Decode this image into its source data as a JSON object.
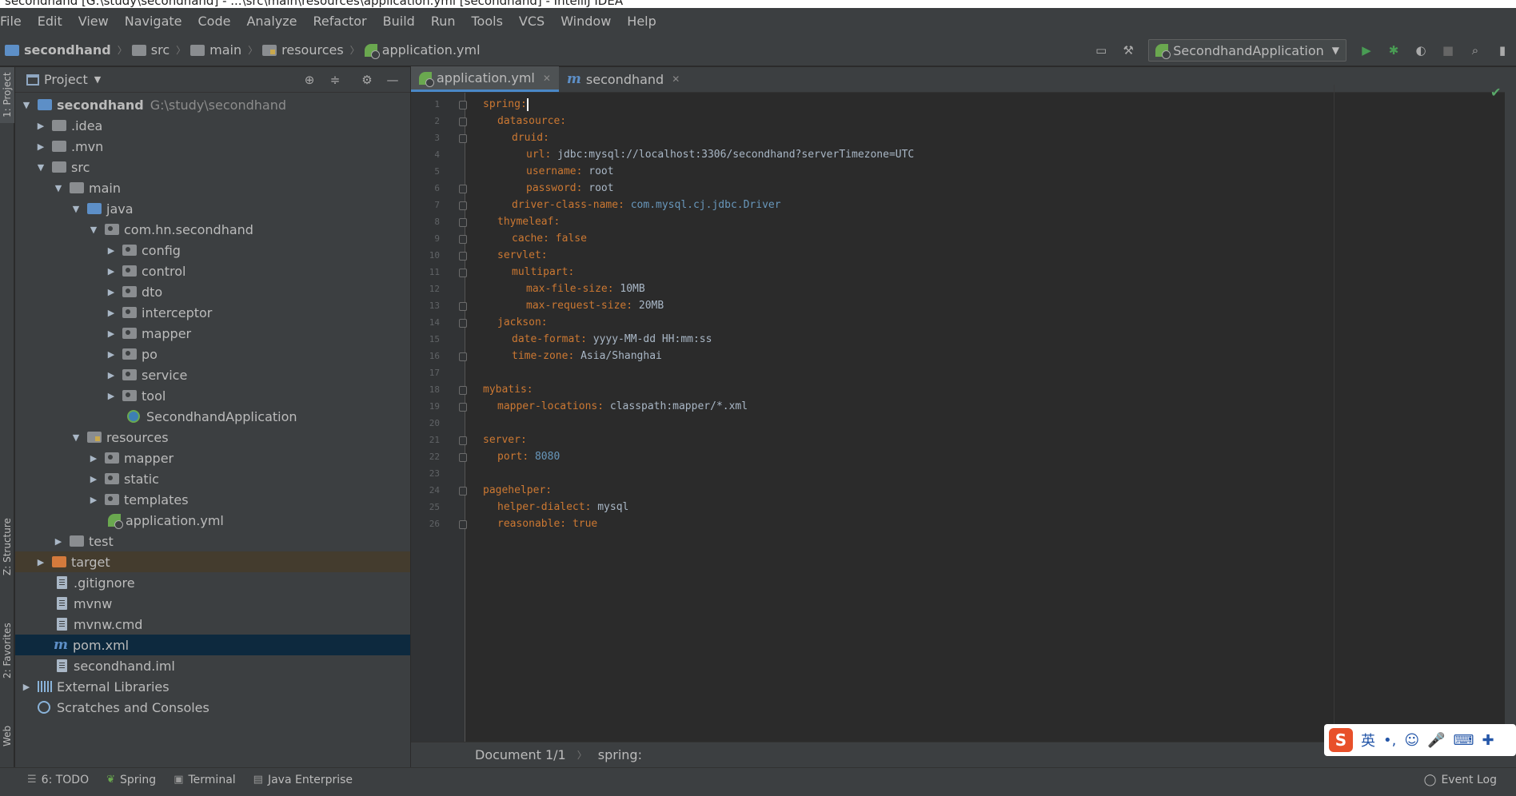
{
  "window": {
    "title": "secondhand [G:\\study\\secondhand] - ...\\src\\main\\resources\\application.yml [secondhand] - IntelliJ IDEA"
  },
  "menu": [
    "File",
    "Edit",
    "View",
    "Navigate",
    "Code",
    "Analyze",
    "Refactor",
    "Build",
    "Run",
    "Tools",
    "VCS",
    "Window",
    "Help"
  ],
  "navbar": {
    "crumbs": [
      "secondhand",
      "src",
      "main",
      "resources",
      "application.yml"
    ],
    "run_config": "SecondhandApplication"
  },
  "side_tabs": {
    "project": "1: Project",
    "structure": "Z: Structure",
    "favorites": "2: Favorites",
    "web": "Web"
  },
  "project_panel": {
    "title": "Project",
    "tree": [
      {
        "label": "secondhand",
        "extra": "G:\\study\\secondhand"
      },
      {
        "label": ".idea"
      },
      {
        "label": ".mvn"
      },
      {
        "label": "src"
      },
      {
        "label": "main"
      },
      {
        "label": "java"
      },
      {
        "label": "com.hn.secondhand"
      },
      {
        "label": "config"
      },
      {
        "label": "control"
      },
      {
        "label": "dto"
      },
      {
        "label": "interceptor"
      },
      {
        "label": "mapper"
      },
      {
        "label": "po"
      },
      {
        "label": "service"
      },
      {
        "label": "tool"
      },
      {
        "label": "SecondhandApplication"
      },
      {
        "label": "resources"
      },
      {
        "label": "mapper"
      },
      {
        "label": "static"
      },
      {
        "label": "templates"
      },
      {
        "label": "application.yml"
      },
      {
        "label": "test"
      },
      {
        "label": "target"
      },
      {
        "label": ".gitignore"
      },
      {
        "label": "mvnw"
      },
      {
        "label": "mvnw.cmd"
      },
      {
        "label": "pom.xml"
      },
      {
        "label": "secondhand.iml"
      },
      {
        "label": "External Libraries"
      },
      {
        "label": "Scratches and Consoles"
      }
    ]
  },
  "editor": {
    "tabs": [
      {
        "label": "application.yml",
        "active": true
      },
      {
        "label": "secondhand",
        "active": false
      }
    ],
    "lines": [
      {
        "n": "1",
        "key": "spring",
        "sep": ":",
        "val": ""
      },
      {
        "n": "2",
        "key": "datasource",
        "sep": ":",
        "val": ""
      },
      {
        "n": "3",
        "key": "druid",
        "sep": ":",
        "val": ""
      },
      {
        "n": "4",
        "key": "url",
        "sep": ": ",
        "val": "jdbc:mysql://localhost:3306/secondhand?serverTimezone=UTC"
      },
      {
        "n": "5",
        "key": "username",
        "sep": ": ",
        "val": "root"
      },
      {
        "n": "6",
        "key": "password",
        "sep": ": ",
        "val": "root"
      },
      {
        "n": "7",
        "key": "driver-class-name",
        "sep": ": ",
        "val": "com.mysql.cj.jdbc.Driver"
      },
      {
        "n": "8",
        "key": "thymeleaf",
        "sep": ":",
        "val": ""
      },
      {
        "n": "9",
        "key": "cache",
        "sep": ": ",
        "val": "false"
      },
      {
        "n": "10",
        "key": "servlet",
        "sep": ":",
        "val": ""
      },
      {
        "n": "11",
        "key": "multipart",
        "sep": ":",
        "val": ""
      },
      {
        "n": "12",
        "key": "max-file-size",
        "sep": ": ",
        "val": "10MB"
      },
      {
        "n": "13",
        "key": "max-request-size",
        "sep": ": ",
        "val": "20MB"
      },
      {
        "n": "14",
        "key": "jackson",
        "sep": ":",
        "val": ""
      },
      {
        "n": "15",
        "key": "date-format",
        "sep": ": ",
        "val": "yyyy-MM-dd HH:mm:ss"
      },
      {
        "n": "16",
        "key": "time-zone",
        "sep": ": ",
        "val": "Asia/Shanghai"
      },
      {
        "n": "17",
        "key": "",
        "sep": "",
        "val": ""
      },
      {
        "n": "18",
        "key": "mybatis",
        "sep": ":",
        "val": ""
      },
      {
        "n": "19",
        "key": "mapper-locations",
        "sep": ": ",
        "val": "classpath:mapper/*.xml"
      },
      {
        "n": "20",
        "key": "",
        "sep": "",
        "val": ""
      },
      {
        "n": "21",
        "key": "server",
        "sep": ":",
        "val": ""
      },
      {
        "n": "22",
        "key": "port",
        "sep": ": ",
        "val": "8080"
      },
      {
        "n": "23",
        "key": "",
        "sep": "",
        "val": ""
      },
      {
        "n": "24",
        "key": "pagehelper",
        "sep": ":",
        "val": ""
      },
      {
        "n": "25",
        "key": "helper-dialect",
        "sep": ": ",
        "val": "mysql"
      },
      {
        "n": "26",
        "key": "reasonable",
        "sep": ": ",
        "val": "true"
      }
    ]
  },
  "breadcrumb": {
    "doc": "Document 1/1",
    "path": "spring:"
  },
  "bottom_tools": [
    "6: TODO",
    "Spring",
    "Terminal",
    "Java Enterprise"
  ],
  "event_log": "Event Log",
  "ime": {
    "logo": "S",
    "lang": "英"
  },
  "colors": {
    "accent": "#4a88c7",
    "selection": "#0d293e",
    "keyword": "#cc7832",
    "number": "#6897bb",
    "string": "#6a8759"
  }
}
